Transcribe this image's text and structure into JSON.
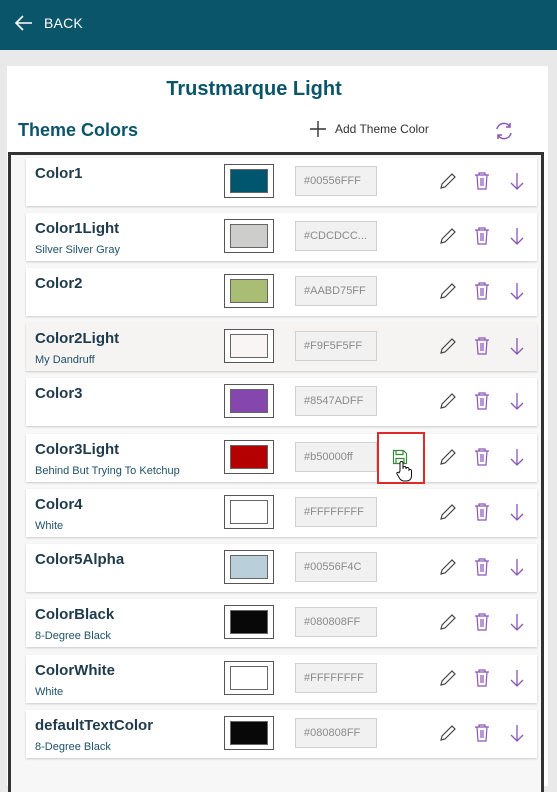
{
  "header": {
    "back_label": "BACK"
  },
  "page": {
    "title": "Trustmarque Light"
  },
  "section": {
    "title": "Theme Colors",
    "add_label": "Add Theme Color"
  },
  "colors": [
    {
      "name": "Color1",
      "subtitle": "",
      "swatch": "#00556F",
      "hex": "#00556FFF"
    },
    {
      "name": "Color1Light",
      "subtitle": "Silver Silver Gray",
      "swatch": "#CDCDCC",
      "hex": "#CDCDCC..."
    },
    {
      "name": "Color2",
      "subtitle": "",
      "swatch": "#AABD75",
      "hex": "#AABD75FF"
    },
    {
      "name": "Color2Light",
      "subtitle": "My Dandruff",
      "swatch": "#F9F5F5",
      "hex": "#F9F5F5FF"
    },
    {
      "name": "Color3",
      "subtitle": "",
      "swatch": "#8547AD",
      "hex": "#8547ADFF"
    },
    {
      "name": "Color3Light",
      "subtitle": "Behind But Trying To Ketchup",
      "swatch": "#B50000",
      "hex": "#b50000ff"
    },
    {
      "name": "Color4",
      "subtitle": "White",
      "swatch": "#FFFFFF",
      "hex": "#FFFFFFFF"
    },
    {
      "name": "Color5Alpha",
      "subtitle": "",
      "swatch": "#B9D0DA",
      "hex": "#00556F4C"
    },
    {
      "name": "ColorBlack",
      "subtitle": "8-Degree Black",
      "swatch": "#080808",
      "hex": "#080808FF"
    },
    {
      "name": "ColorWhite",
      "subtitle": "White",
      "swatch": "#FFFFFF",
      "hex": "#FFFFFFFF"
    },
    {
      "name": "defaultTextColor",
      "subtitle": "8-Degree Black",
      "swatch": "#080808",
      "hex": "#080808FF"
    }
  ],
  "theme": {
    "brand": "#0b556b",
    "icon_purple": "#8a55b8",
    "save_green": "#3b8a3b",
    "highlight_red": "#e02a2a"
  }
}
